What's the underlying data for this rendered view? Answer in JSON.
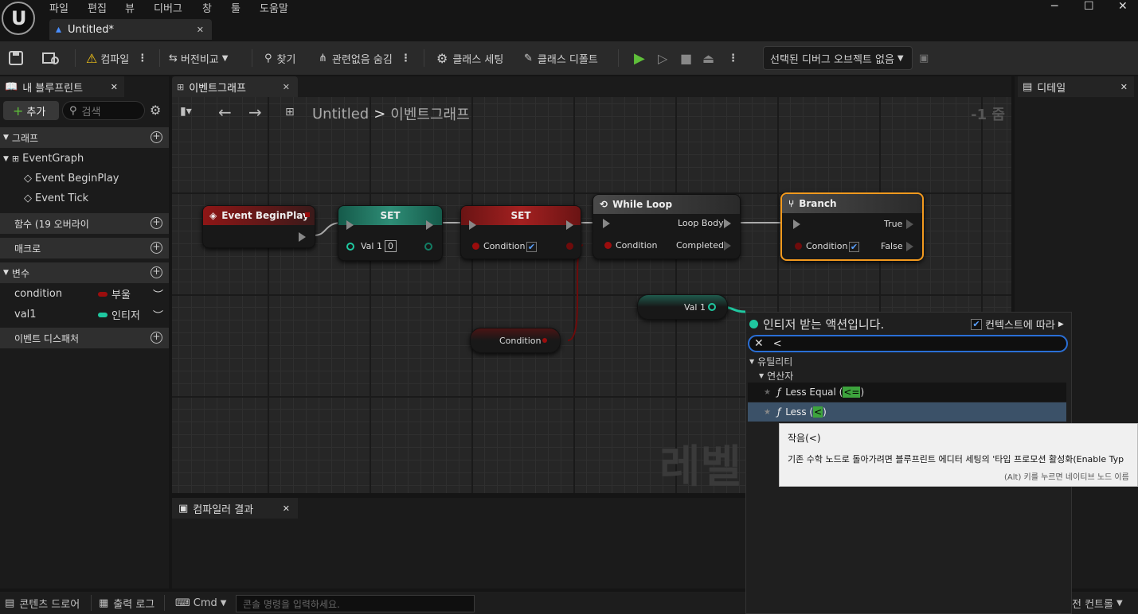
{
  "menu": [
    "파일",
    "편집",
    "뷰",
    "디버그",
    "창",
    "툴",
    "도움말"
  ],
  "logo_text": "U",
  "window_controls": {
    "minimize": "─",
    "maximize": "☐",
    "close": "✕"
  },
  "doc_tab": {
    "title": "Untitled*",
    "close": "✕"
  },
  "toolbar": {
    "compile": "컴파일",
    "diff": "버전비교",
    "find": "찾기",
    "hide_unrelated": "관련없음 숨김",
    "class_settings": "클래스 세팅",
    "class_defaults": "클래스 디폴트",
    "debug_object": "선택된 디버그 오브젝트 없음"
  },
  "left_panel": {
    "tab": "내 블루프린트",
    "add": "추가",
    "search_placeholder": "검색",
    "graphs": "그래프",
    "event_graph": "EventGraph",
    "event_begin_play": "Event BeginPlay",
    "event_tick": "Event Tick",
    "functions": "함수 (19 오버라이",
    "macros": "매크로",
    "variables": "변수",
    "vars": [
      {
        "name": "condition",
        "type": "부울",
        "color": "#9b0d0d"
      },
      {
        "name": "val1",
        "type": "인티저",
        "color": "#1fc8a0"
      }
    ],
    "dispatchers": "이벤트 디스패처"
  },
  "graph": {
    "tab": "이벤트그래프",
    "breadcrumb_root": "Untitled",
    "breadcrumb_sep": ">",
    "breadcrumb_leaf": "이벤트그래프",
    "zoom": "-1 줌",
    "watermark": "레벨",
    "nodes": {
      "begin_play": "Event BeginPlay",
      "set1": "SET",
      "set1_pin": "Val 1",
      "set1_val": "0",
      "set2": "SET",
      "set2_pin": "Condition",
      "while_loop": "While Loop",
      "loop_body": "Loop Body",
      "wl_condition": "Condition",
      "completed": "Completed",
      "branch": "Branch",
      "true": "True",
      "false": "False",
      "br_condition": "Condition",
      "get_val1": "Val 1",
      "get_condition": "Condition"
    }
  },
  "details": {
    "tab": "디테일"
  },
  "compiler": {
    "tab": "컴파일러 결과"
  },
  "popup": {
    "title": "인티저 받는 액션입니다.",
    "context": "컨텍스트에 따라",
    "search_value": "<",
    "cat_utility": "유틸리티",
    "cat_operator": "연산자",
    "item1": "Less Equal (",
    "item1_sym": "<=",
    "item1_end": ")",
    "item2": "Less (",
    "item2_sym": "<",
    "item2_end": ")"
  },
  "tooltip": {
    "title": "작음(<)",
    "body": "기존 수학 노드로 돌아가려면 블루프린트 에디터 세팅의 '타입 프로모션 활성화(Enable Typ",
    "hint": "(Alt) 키를 누르면 네이티브 노드 이름"
  },
  "statusbar": {
    "content_drawer": "콘텐츠 드로어",
    "output_log": "출력 로그",
    "cmd": "Cmd",
    "console_placeholder": "콘솔 명령을 입력하세요.",
    "source_control": "전 컨트롤"
  }
}
